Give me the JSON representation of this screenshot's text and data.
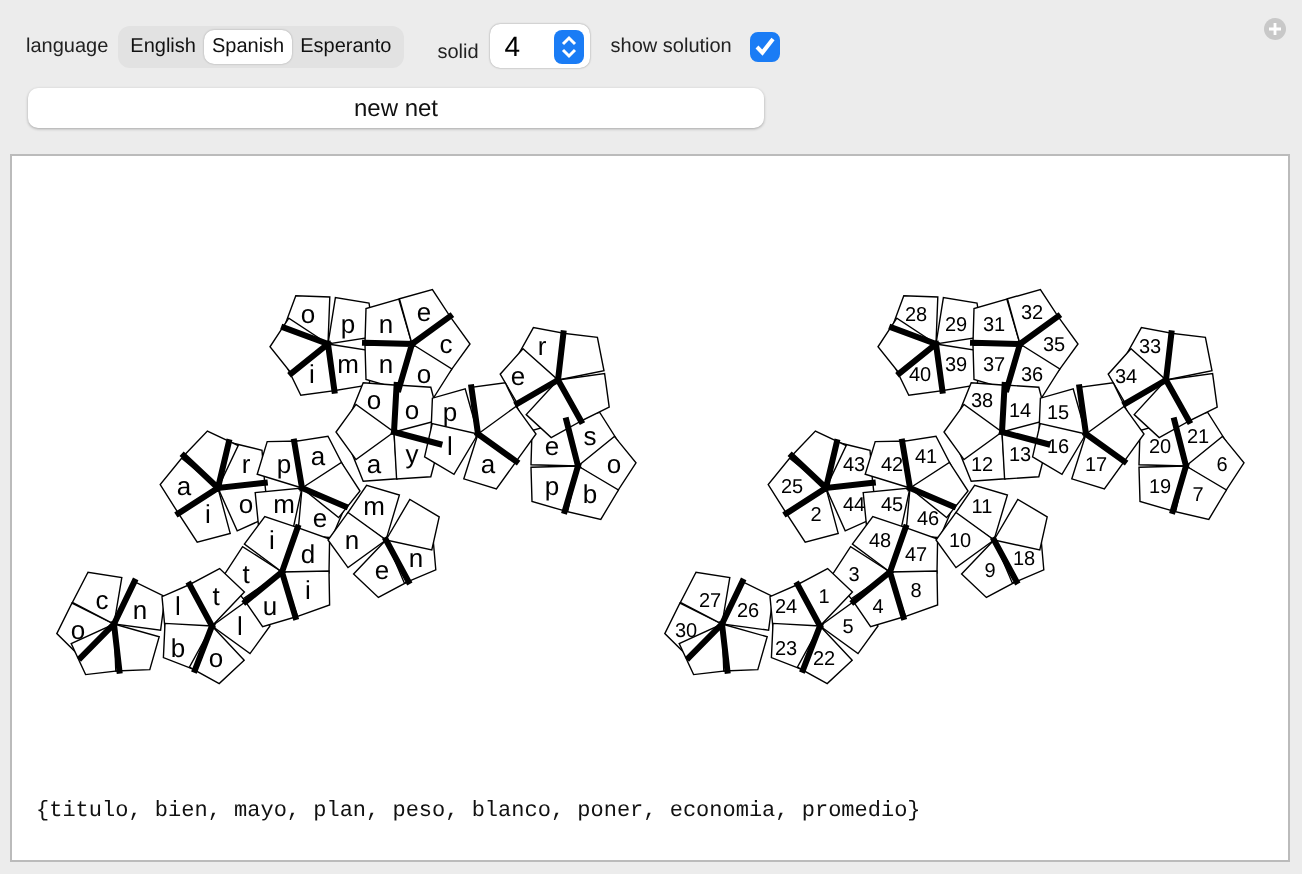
{
  "controls": {
    "language_label": "language",
    "languages": [
      {
        "label": "English",
        "selected": false
      },
      {
        "label": "Spanish",
        "selected": true
      },
      {
        "label": "Esperanto",
        "selected": false
      }
    ],
    "solid_label": "solid",
    "solid_value": "4",
    "show_solution_label": "show solution",
    "show_solution": true
  },
  "new_net_button": "new net",
  "letter_net": {
    "labels": [
      "o",
      "p",
      "n",
      "e",
      "c",
      "r",
      "i",
      "m",
      "n",
      "o",
      "e",
      "o",
      "o",
      "p",
      "r",
      "p",
      "a",
      "a",
      "y",
      "l",
      "a",
      "e",
      "s",
      "o",
      "a",
      "i",
      "o",
      "m",
      "e",
      "m",
      "p",
      "b",
      "t",
      "i",
      "d",
      "n",
      "e",
      "n",
      "o",
      "c",
      "n",
      "l",
      "t",
      "l",
      "u",
      "i",
      "b",
      "o"
    ]
  },
  "number_net": {
    "labels": [
      "28",
      "29",
      "31",
      "32",
      "35",
      "33",
      "40",
      "39",
      "37",
      "36",
      "34",
      "38",
      "14",
      "15",
      "43",
      "42",
      "41",
      "12",
      "13",
      "16",
      "17",
      "20",
      "21",
      "6",
      "25",
      "2",
      "44",
      "45",
      "46",
      "11",
      "19",
      "7",
      "3",
      "48",
      "47",
      "10",
      "9",
      "18",
      "30",
      "27",
      "26",
      "24",
      "1",
      "5",
      "4",
      "8",
      "23",
      "22"
    ]
  },
  "word_list": "{titulo, bien, mayo, plan, peso, blanco, poner, economia, promedio}"
}
